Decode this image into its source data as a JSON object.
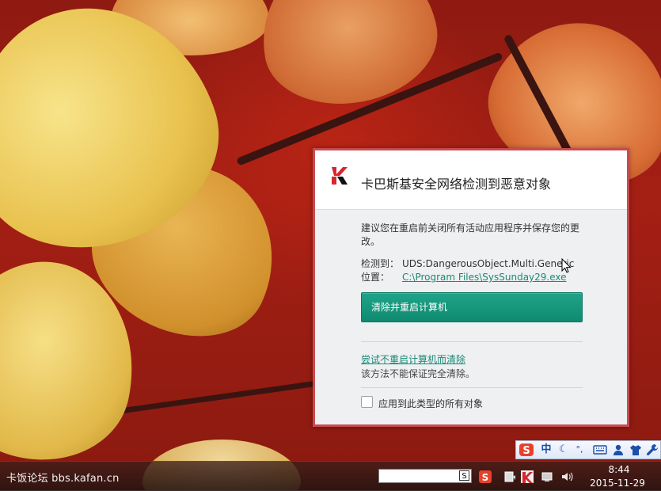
{
  "dialog": {
    "title": "卡巴斯基安全网络检测到恶意对象",
    "advice": "建议您在重启前关闭所有活动应用程序并保存您的更改。",
    "detected_label": "检测到：",
    "detected_value": "UDS:DangerousObject.Multi.Generic",
    "location_label": "位置：",
    "location_value": "C:\\Program Files\\SysSunday29.exe",
    "primary_button": "清除并重启计算机",
    "alt_link": "尝试不重启计算机而清除",
    "alt_note": "该方法不能保证完全清除。",
    "checkbox_label": "应用到此类型的所有对象",
    "checkbox_checked": false,
    "accent_color": "#c94a4f",
    "button_color": "#129a7e"
  },
  "ime": {
    "logo": "S",
    "mode": "中",
    "punct": "°,",
    "items": [
      "sogou-logo",
      "chinese-mode",
      "moon-icon",
      "punctuation",
      "keyboard-icon",
      "user-icon",
      "skin-icon",
      "wrench-icon"
    ]
  },
  "taskbar": {
    "watermark": "卡饭论坛 bbs.kafan.cn",
    "search_button": "S",
    "time": "8:44",
    "date": "2015-11-29"
  }
}
